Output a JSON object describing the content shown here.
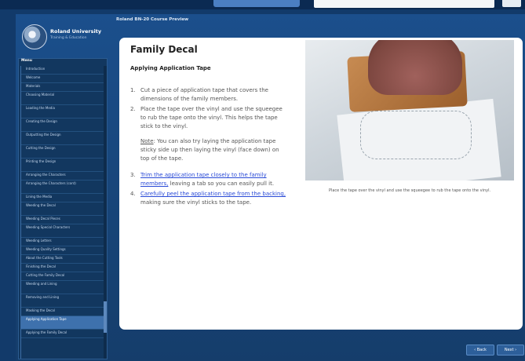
{
  "brand": {
    "name": "Roland University",
    "tagline": "Training & Education"
  },
  "course_title": "Roland BN-20 Course Preview",
  "sidebar": {
    "menu_label": "Menu",
    "items": [
      "Introduction",
      "Welcome",
      "Materials",
      "Choosing Material",
      "Loading the Media",
      "Creating the Design",
      "Outputting the Design",
      "Cutting the Design",
      "Printing the Design",
      "Arranging the Characters",
      "Arranging the Characters (cont)",
      "Lining the Media",
      "Weeding the Decal",
      "Weeding Decal Pieces",
      "Weeding Special Characters",
      "Weeding Letters",
      "Weeding Quality Settings",
      "About the Cutting Tools",
      "Finishing the Decal",
      "Cutting the Family Decal",
      "Weeding and Lining",
      "Removing and Lining",
      "Masking the Decal",
      "Applying Application Tape",
      "Applying the Family Decal"
    ]
  },
  "content": {
    "lesson_title": "Family Decal",
    "section_title": "Applying Application Tape",
    "steps": [
      {
        "num": "1.",
        "text": "Cut a piece of application tape that covers the dimensions of the family members.",
        "link": "",
        "after": ""
      },
      {
        "num": "2.",
        "text": "Place the tape over the vinyl and use the squeegee to rub the tape onto the vinyl. This helps the tape stick to the vinyl.",
        "link": "",
        "after": ""
      },
      {
        "num": "3.",
        "text": "",
        "link": "Trim the application tape closely to the family members,",
        "after": " leaving a tab so you can easily pull it."
      },
      {
        "num": "4.",
        "text": "",
        "link": "Carefully peel the application tape from the backing,",
        "after": " making sure the vinyl sticks to the tape."
      }
    ],
    "note_label": "Note",
    "note_text": ": You can also try laying the application tape sticky side up then laying the vinyl (face down) on top of the tape.",
    "caption": "Place the tape over the vinyl and use the squeegee to rub the tape onto the vinyl."
  },
  "nav": {
    "prev": "‹ Back",
    "next": "Next ›"
  }
}
